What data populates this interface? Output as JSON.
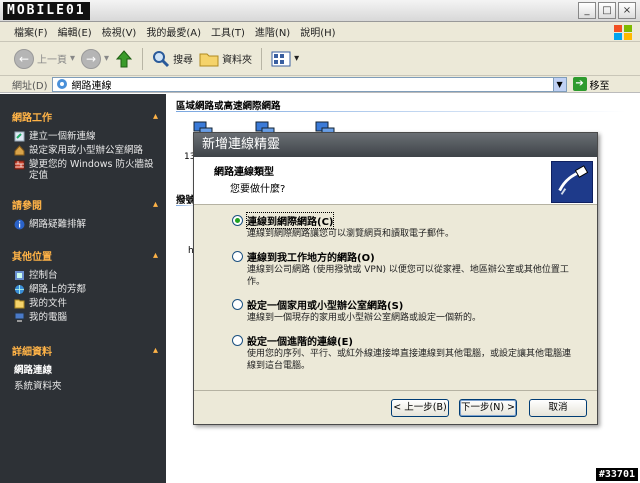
{
  "logo_text": "MOBILE01",
  "window_buttons": [
    "_",
    "□",
    "×"
  ],
  "menu": [
    "檔案(F)",
    "編輯(E)",
    "檢視(V)",
    "我的最愛(A)",
    "工具(T)",
    "進階(N)",
    "說明(H)"
  ],
  "toolbar": {
    "back": "上一頁",
    "search": "搜尋",
    "folders": "資料夾"
  },
  "address": {
    "label": "網址(D)",
    "value": "網路連線",
    "go": "移至"
  },
  "sidebar": {
    "tasks": {
      "title": "網路工作",
      "items": [
        "建立一個新連線",
        "設定家用或小型辦公室網路",
        "變更您的 Windows 防火牆設定值"
      ]
    },
    "see_also": {
      "title": "請參閱",
      "items": [
        "網路疑難排解"
      ]
    },
    "other_places": {
      "title": "其他位置",
      "items": [
        "控制台",
        "網路上的芳鄰",
        "我的文件",
        "我的電腦"
      ]
    },
    "details": {
      "title": "詳細資料",
      "name": "網路連線",
      "type": "系統資料夾"
    }
  },
  "content": {
    "group1": "區域網路或高速網際網路",
    "group2": "撥號",
    "stub1": "13",
    "stub2": "h"
  },
  "dialog": {
    "title": "新增連線精靈",
    "header_title": "網路連線類型",
    "header_sub": "您要做什麼?",
    "options": [
      {
        "label": "連線到網際網路(C)",
        "desc": "連線到網際網路讓您可以瀏覽網頁和讀取電子郵件。",
        "selected": true
      },
      {
        "label": "連線到我工作地方的網路(O)",
        "desc": "連線到公司網路 (使用撥號或 VPN) 以便您可以從家裡、地區辦公室或其他位置工作。",
        "selected": false
      },
      {
        "label": "設定一個家用或小型辦公室網路(S)",
        "desc": "連線到一個現存的家用或小型辦公室網路或設定一個新的。",
        "selected": false
      },
      {
        "label": "設定一個進階的連線(E)",
        "desc": "使用您的序列、平行、或紅外線連接埠直接連線到其他電腦，或設定讓其他電腦連線到這台電腦。",
        "selected": false
      }
    ],
    "buttons": {
      "back": "< 上一步(B)",
      "next": "下一步(N) >",
      "cancel": "取消"
    }
  },
  "watermark": "#33701"
}
